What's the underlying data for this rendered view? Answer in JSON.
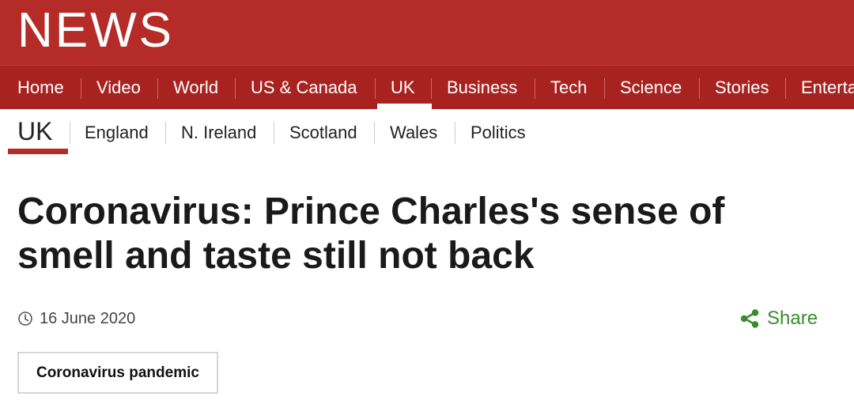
{
  "brand": {
    "logo_text": "NEWS",
    "color": "#b42b27"
  },
  "primary_nav": {
    "items": [
      {
        "label": "Home"
      },
      {
        "label": "Video"
      },
      {
        "label": "World"
      },
      {
        "label": "US & Canada"
      },
      {
        "label": "UK",
        "active": true
      },
      {
        "label": "Business"
      },
      {
        "label": "Tech"
      },
      {
        "label": "Science"
      },
      {
        "label": "Stories"
      },
      {
        "label": "Enterta"
      }
    ]
  },
  "secondary_nav": {
    "title": "UK",
    "items": [
      {
        "label": "England"
      },
      {
        "label": "N. Ireland"
      },
      {
        "label": "Scotland"
      },
      {
        "label": "Wales"
      },
      {
        "label": "Politics"
      }
    ]
  },
  "article": {
    "headline": "Coronavirus: Prince Charles's sense of smell and taste still not back",
    "date": "16 June 2020",
    "date_icon": "clock-icon",
    "share_label": "Share",
    "share_icon": "share-icon",
    "share_color": "#3b8c2e",
    "tag_label": "Coronavirus pandemic"
  }
}
